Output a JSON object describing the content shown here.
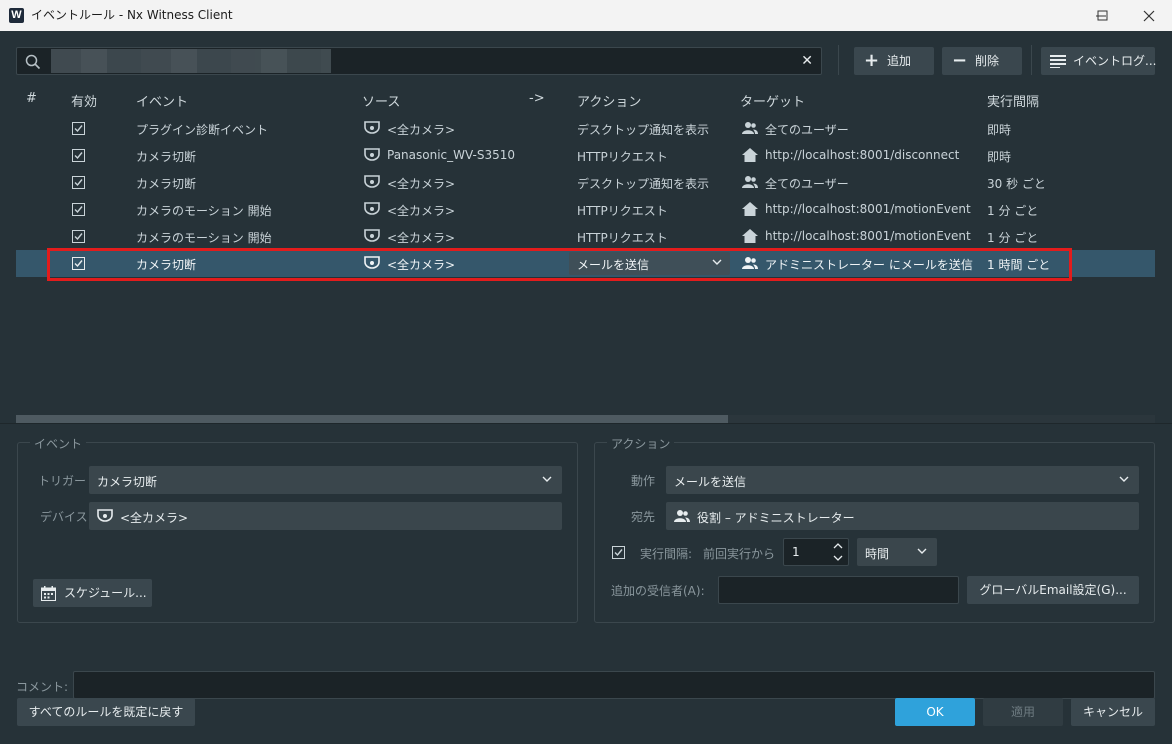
{
  "window": {
    "title": "イベントルール - Nx Witness Client",
    "app_icon": "W"
  },
  "toolbar": {
    "search_value": "■■■■■■■■",
    "add_label": "追加",
    "delete_label": "削除",
    "event_log_label": "イベントログ..."
  },
  "table": {
    "headers": [
      "#",
      "有効",
      "イベント",
      "ソース",
      "->",
      "アクション",
      "ターゲット",
      "実行間隔"
    ],
    "rows": [
      {
        "event": "プラグイン診断イベント",
        "source": "<全カメラ>",
        "action": "デスクトップ通知を表示",
        "target": "全てのユーザー",
        "interval": "即時"
      },
      {
        "event": "カメラ切断",
        "source": "Panasonic_WV-S3510",
        "action": "HTTPリクエスト",
        "target": "http://localhost:8001/disconnect",
        "interval": "即時"
      },
      {
        "event": "カメラ切断",
        "source": "<全カメラ>",
        "action": "デスクトップ通知を表示",
        "target": "全てのユーザー",
        "interval": "30 秒 ごと"
      },
      {
        "event": "カメラのモーション 開始",
        "source": "<全カメラ>",
        "action": "HTTPリクエスト",
        "target": "http://localhost:8001/motionEvent",
        "interval": "1 分 ごと"
      },
      {
        "event": "カメラのモーション 開始",
        "source": "<全カメラ>",
        "action": "HTTPリクエスト",
        "target": "http://localhost:8001/motionEvent",
        "interval": "1 分 ごと"
      },
      {
        "event": "カメラ切断",
        "source": "<全カメラ>",
        "action": "メールを送信",
        "target": "アドミニストレーター にメールを送信",
        "interval": "1 時間 ごと"
      }
    ]
  },
  "event_group": {
    "title": "イベント",
    "trigger_label": "トリガー",
    "trigger_value": "カメラ切断",
    "device_label": "デバイス",
    "device_value": "<全カメラ>",
    "schedule_label": "スケジュール..."
  },
  "action_group": {
    "title": "アクション",
    "action_label": "動作",
    "action_value": "メールを送信",
    "recipient_label": "宛先",
    "recipient_value": "役割 – アドミニストレーター",
    "interval_label": "実行間隔:",
    "interval_from": "前回実行から",
    "interval_value": "1",
    "interval_unit": "時間",
    "extra_recipients_label": "追加の受信者(A):",
    "global_email_label": "グローバルEmail設定(G)..."
  },
  "comment_label": "コメント:",
  "footer": {
    "reset_label": "すべてのルールを既定に戻す",
    "ok_label": "OK",
    "apply_label": "適用",
    "cancel_label": "キャンセル"
  },
  "colors": {
    "accent": "#2fa2db",
    "selection": "#35576b",
    "highlight": "#e31c1c"
  }
}
